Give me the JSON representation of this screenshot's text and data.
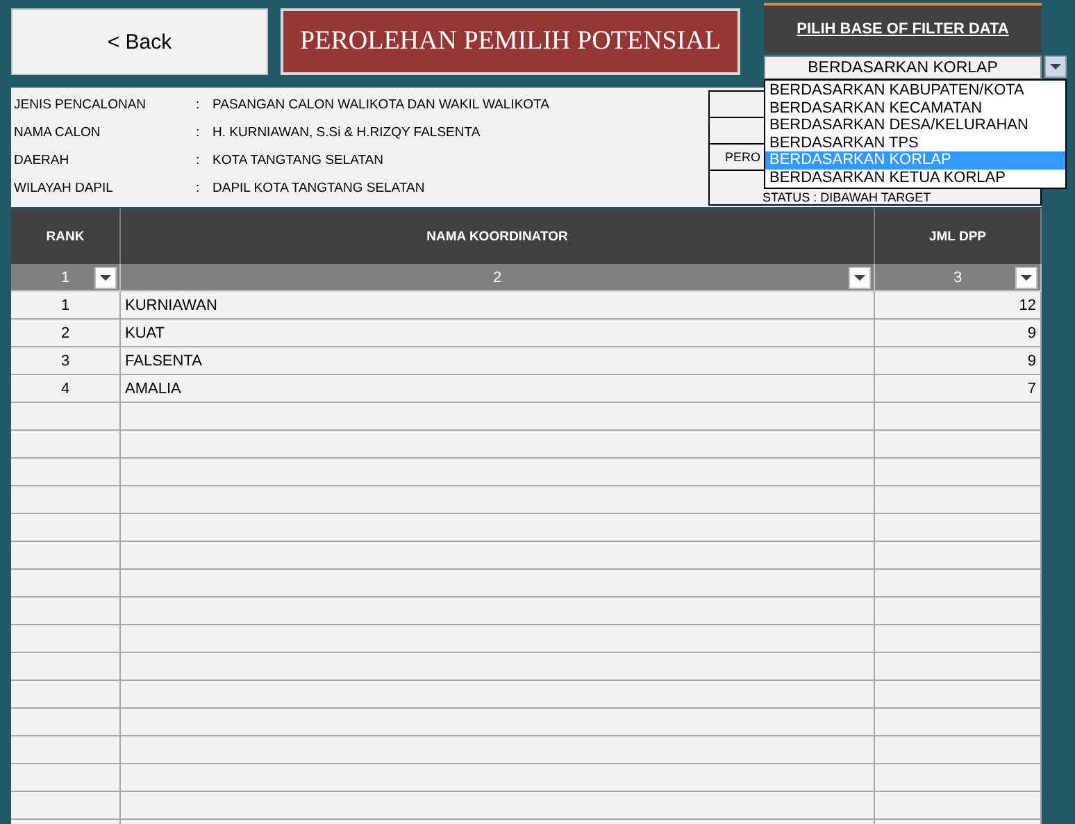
{
  "back_button": {
    "label": "< Back"
  },
  "title": "PEROLEHAN PEMILIH POTENSIAL",
  "filter": {
    "heading": "PILIH BASE OF FILTER DATA",
    "value": "BERDASARKAN KORLAP",
    "expanded": true,
    "options": [
      {
        "label": "BERDASARKAN KABUPATEN/KOTA",
        "selected": false
      },
      {
        "label": "BERDASARKAN KECAMATAN",
        "selected": false
      },
      {
        "label": "BERDASARKAN DESA/KELURAHAN",
        "selected": false
      },
      {
        "label": "BERDASARKAN TPS",
        "selected": false
      },
      {
        "label": "BERDASARKAN KORLAP",
        "selected": true
      },
      {
        "label": "BERDASARKAN KETUA KORLAP",
        "selected": false
      }
    ]
  },
  "info": [
    {
      "label": "JENIS PENCALONAN",
      "separator": ":",
      "value": "PASANGAN CALON WALIKOTA DAN WAKIL WALIKOTA"
    },
    {
      "label": "NAMA CALON",
      "separator": ":",
      "value": "H. KURNIAWAN, S.Si & H.RIZQY FALSENTA"
    },
    {
      "label": "DAERAH",
      "separator": ":",
      "value": "KOTA TANGTANG SELATAN"
    },
    {
      "label": "WILAYAH DAPIL",
      "separator": ":",
      "value": "DAPIL KOTA TANGTANG SELATAN"
    }
  ],
  "summary_rows": [
    "PERO",
    "STATUS : DIBAWAH TARGET"
  ],
  "table": {
    "columns": [
      {
        "name": "RANK",
        "filter_label": "1"
      },
      {
        "name": "NAMA KOORDINATOR",
        "filter_label": "2"
      },
      {
        "name": "JML DPP",
        "filter_label": "3"
      }
    ],
    "rows": [
      [
        "1",
        "KURNIAWAN",
        "12"
      ],
      [
        "2",
        "KUAT",
        "9"
      ],
      [
        "3",
        "FALSENTA",
        "9"
      ],
      [
        "4",
        "AMALIA",
        "7"
      ]
    ]
  }
}
